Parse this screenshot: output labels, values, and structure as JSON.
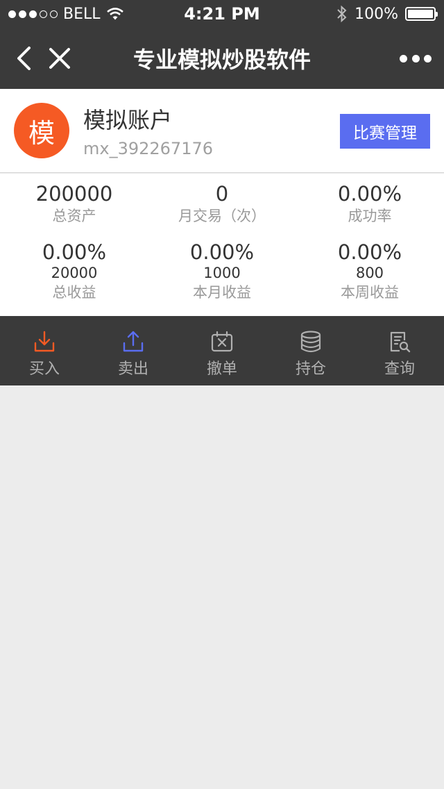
{
  "status": {
    "carrier": "BELL",
    "time": "4:21 PM",
    "battery": "100%",
    "signal_bars": 3,
    "signal_total": 5
  },
  "nav": {
    "title": "专业模拟炒股软件"
  },
  "account": {
    "avatar_text": "模",
    "name": "模拟账户",
    "id": "mx_392267176",
    "manage_label": "比赛管理",
    "avatar_color": "#f55a24",
    "manage_color": "#5a6df0"
  },
  "stats": {
    "total_assets": {
      "value": "200000",
      "label": "总资产"
    },
    "monthly_trades": {
      "value": "0",
      "label": "月交易（次）"
    },
    "success_rate": {
      "value": "0.00%",
      "label": "成功率"
    },
    "total_return": {
      "value": "0.00%",
      "sub": "20000",
      "label": "总收益"
    },
    "month_return": {
      "value": "0.00%",
      "sub": "1000",
      "label": "本月收益"
    },
    "week_return": {
      "value": "0.00%",
      "sub": "800",
      "label": "本周收益"
    }
  },
  "toolbar": {
    "buy": {
      "label": "买入",
      "icon": "download-icon",
      "color": "#f55a24"
    },
    "sell": {
      "label": "卖出",
      "icon": "upload-icon",
      "color": "#5a6df0"
    },
    "cancel": {
      "label": "撤单",
      "icon": "calendar-x-icon"
    },
    "holdings": {
      "label": "持仓",
      "icon": "database-icon"
    },
    "query": {
      "label": "查询",
      "icon": "search-document-icon"
    }
  }
}
